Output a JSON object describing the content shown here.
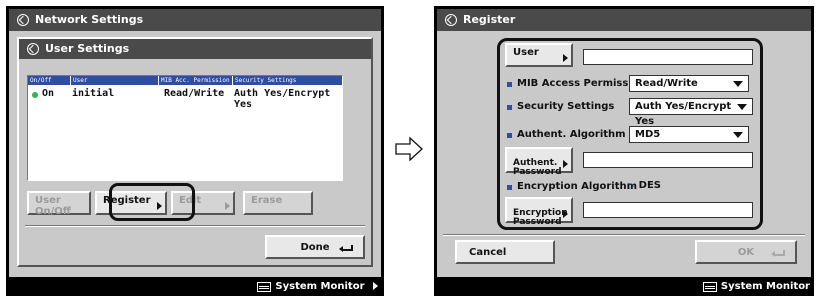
{
  "left_panel": {
    "title": "Network Settings",
    "dialog_title": "User Settings",
    "table": {
      "headers": [
        "On/Off",
        "User",
        "MIB Acc. Permission",
        "Security Settings"
      ],
      "rows": [
        {
          "status": "On",
          "user": "initial",
          "permission": "Read/Write",
          "security": "Auth Yes/Encrypt Yes"
        }
      ]
    },
    "buttons": {
      "user_onoff": "User On/Off",
      "register": "Register",
      "edit": "Edit",
      "erase": "Erase",
      "done": "Done"
    },
    "system_monitor": "System Monitor"
  },
  "right_panel": {
    "title": "Register",
    "user_button": "User",
    "user_value": "",
    "mib_label": "MIB Access Permission",
    "mib_value": "Read/Write",
    "security_label": "Security Settings",
    "security_value": "Auth Yes/Encrypt Yes",
    "auth_alg_label": "Authent. Algorithm",
    "auth_alg_value": "MD5",
    "auth_pw_button": "Authent.\nPassword",
    "auth_pw_value": "",
    "enc_alg_label": "Encryption Algorithm",
    "enc_alg_value": "DES",
    "enc_pw_button": "Encryption\nPassword",
    "enc_pw_value": "",
    "cancel": "Cancel",
    "ok": "OK",
    "system_monitor": "System Monitor"
  },
  "colors": {
    "accent": "#2e4e9e",
    "status_on": "#2db84a",
    "titlebar": "#4a4a4a",
    "panel_bg": "#c9c9c9"
  }
}
